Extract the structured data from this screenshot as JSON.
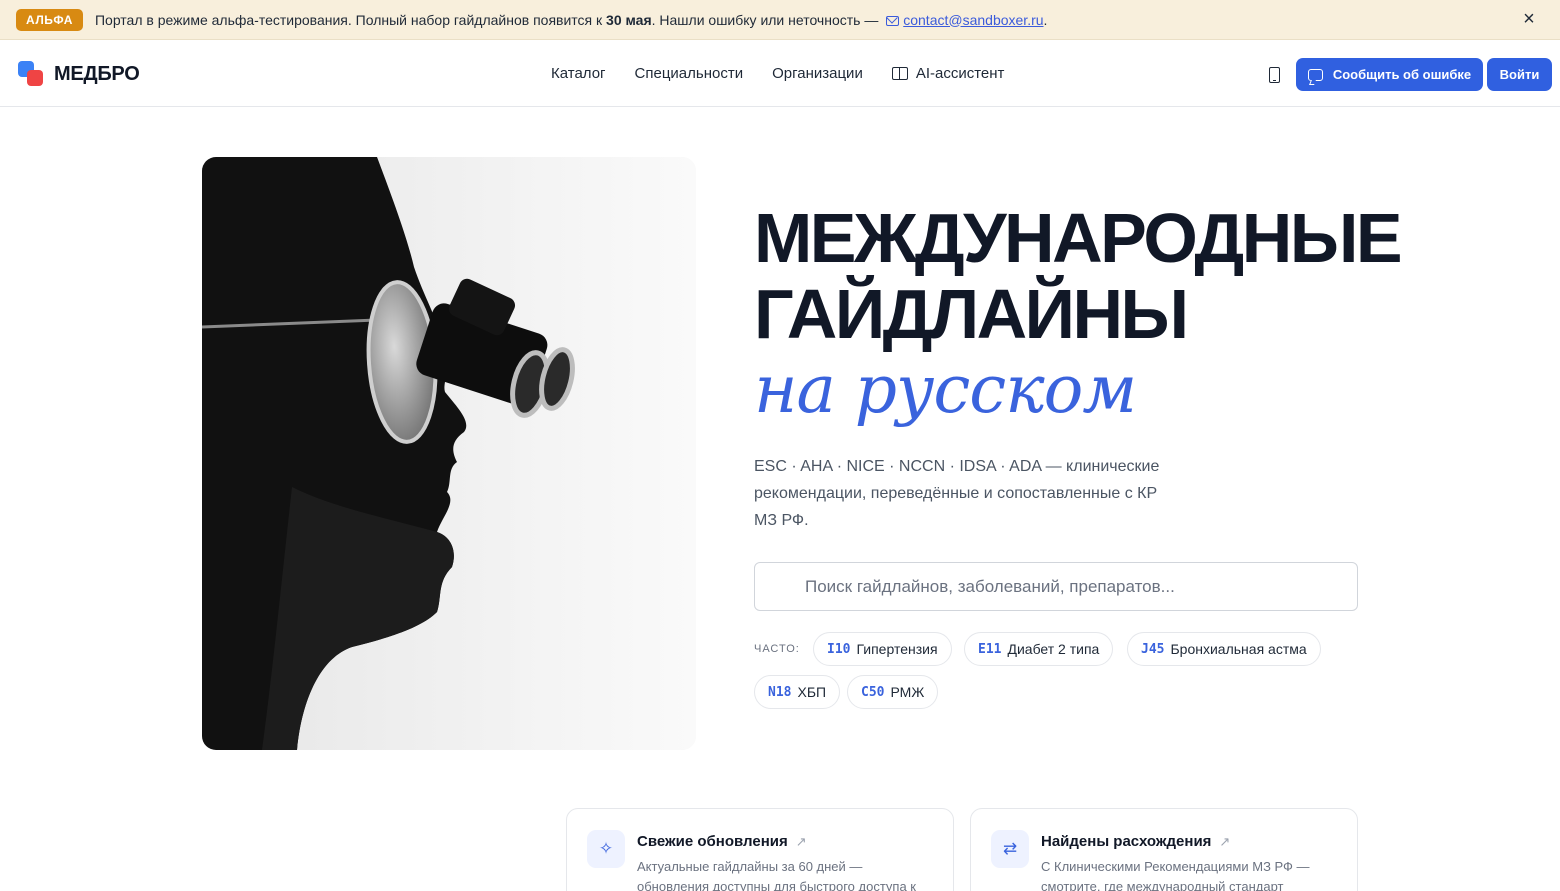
{
  "banner": {
    "badge": "АЛЬФА",
    "text_before": "Портал в режиме альфа-тестирования. Полный набор гайдлайнов появится к ",
    "date": "30 мая",
    "text_after": ". Нашли ошибку или неточность — ",
    "email": "contact@sandboxer.ru",
    "trailing": ".",
    "close": "×"
  },
  "header": {
    "logo": "МЕДБРО",
    "nav": [
      "Каталог",
      "Специальности",
      "Организации",
      "AI-ассистент"
    ],
    "report_button": "Сообщить об ошибке",
    "login_button": "Войти"
  },
  "hero": {
    "title_line1": "МЕЖДУНАРОДНЫЕ",
    "title_line2": "ГАЙДЛАЙНЫ",
    "subtitle": "на русском",
    "description": "ESC · AHA · NICE · NCCN · IDSA · ADA — клинические рекомендации, переведённые и сопоставленные с КР МЗ РФ.",
    "search_placeholder": "Поиск гайдлайнов, заболеваний, препаратов...",
    "often_label": "ЧАСТО:",
    "chips": [
      {
        "code": "I10",
        "label": "Гипертензия"
      },
      {
        "code": "E11",
        "label": "Диабет 2 типа"
      },
      {
        "code": "J45",
        "label": "Бронхиальная астма"
      },
      {
        "code": "N18",
        "label": "ХБП"
      },
      {
        "code": "C50",
        "label": "РМЖ"
      }
    ]
  },
  "cards": [
    {
      "title": "Свежие обновления",
      "arrow": "↗",
      "description": "Актуальные гайдлайны за 60 дней — обновления доступны для быстрого доступа к"
    },
    {
      "title": "Найдены расхождения",
      "arrow": "↗",
      "description": "С Клиническими Рекомендациями МЗ РФ — смотрите, где международный стандарт"
    }
  ],
  "colors": {
    "accent": "#3060e0",
    "badge": "#d88a12",
    "banner_bg": "#f8efdc"
  }
}
